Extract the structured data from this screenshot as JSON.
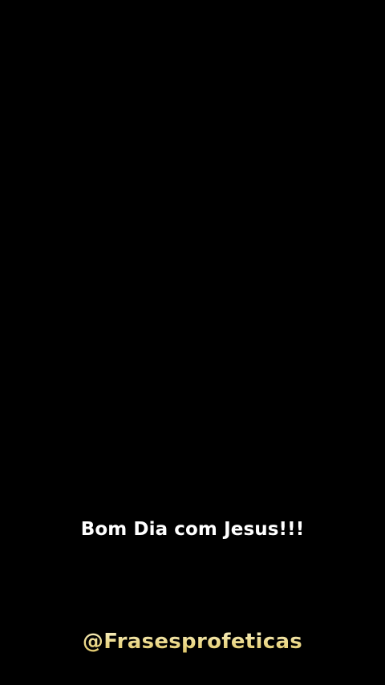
{
  "video": {
    "caption": "Bom Dia com Jesus!!!",
    "watermark": "@Frasesprofeticas"
  },
  "colors": {
    "background": "#000000",
    "caption_text": "#ffffff",
    "watermark_text": "#ecd98a"
  }
}
